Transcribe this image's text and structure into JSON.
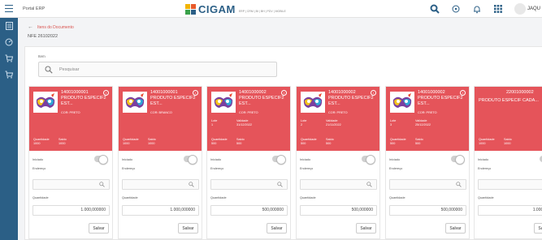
{
  "header": {
    "portal_label": "Portal ERP",
    "brand": "CIGAM",
    "brand_subtitle": "ERP | CRM | BI | BH | PDV | MOBILE",
    "user_name": "JAQU"
  },
  "breadcrumb": {
    "back_label": "Itens do Documento"
  },
  "page": {
    "subtitle": "NFE 26102022"
  },
  "search": {
    "label": "Item",
    "placeholder": "Pesquisar"
  },
  "labels": {
    "quantidade": "Quantidade",
    "saldo": "Saldo",
    "lote": "Lote",
    "validade": "Validade",
    "iniciado": "Iniciado",
    "endereco": "Endereço",
    "quantidade_body": "Quantidade",
    "salvar": "Salvar"
  },
  "cards": [
    {
      "code": "14001000001",
      "name": "PRODUTO ESPECIF2 EST...",
      "color": "COR: PRETO",
      "lote": "",
      "validade": "",
      "quantidade": "1000",
      "saldo": "1000",
      "qty_value": "1.000,000000"
    },
    {
      "code": "14001000001",
      "name": "PRODUTO ESPECIF2 EST...",
      "color": "COR: BRANCO",
      "lote": "",
      "validade": "",
      "quantidade": "1000",
      "saldo": "1000",
      "qty_value": "1.000,000000"
    },
    {
      "code": "14001000002",
      "name": "PRODUTO ESPECIF2 EST...",
      "color": "COR: PRETO",
      "lote": "1",
      "validade": "31/12/2022",
      "quantidade": "500",
      "saldo": "500",
      "qty_value": "500,000000"
    },
    {
      "code": "14001000002",
      "name": "PRODUTO ESPECIF2 EST...",
      "color": "COR: PRETO",
      "lote": "2",
      "validade": "21/11/2022",
      "quantidade": "500",
      "saldo": "500",
      "qty_value": "500,000000"
    },
    {
      "code": "14001000002",
      "name": "PRODUTO ESPECIF2 EST...",
      "color": "COR: PRETO",
      "lote": "3",
      "validade": "25/12/2022",
      "quantidade": "500",
      "saldo": "500",
      "qty_value": "500,000000"
    },
    {
      "code": "22001000002",
      "name": "PRODUTO ESPECIF CADA...",
      "color": "",
      "lote": "",
      "validade": "",
      "quantidade": "1000",
      "saldo": "1000",
      "qty_value": "1.000,000"
    }
  ],
  "colors": {
    "primary": "#2b5f86",
    "card_header": "#e5545a",
    "breadcrumb": "#d9534f"
  }
}
